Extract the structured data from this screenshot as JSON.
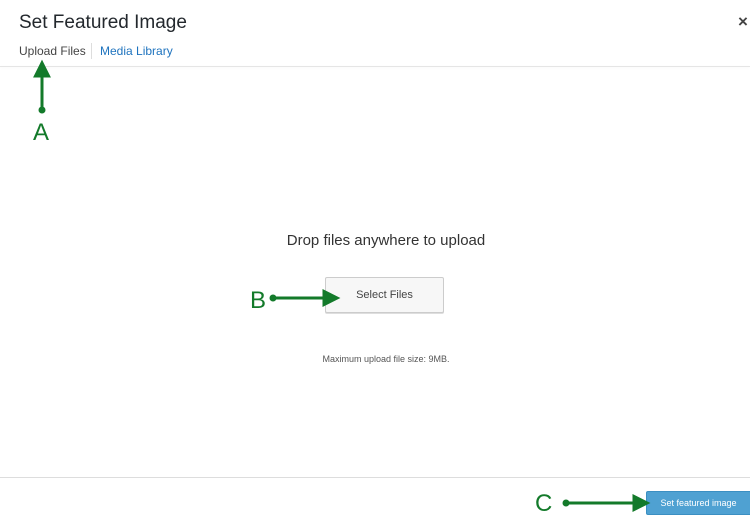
{
  "dialog": {
    "title": "Set Featured Image",
    "close_glyph": "×",
    "tabs": [
      {
        "label": "Upload Files",
        "active": true
      },
      {
        "label": "Media Library",
        "active": false
      }
    ]
  },
  "uploader": {
    "heading": "Drop files anywhere to upload",
    "select_button_label": "Select Files",
    "max_size_text": "Maximum upload file size: 9MB."
  },
  "footer": {
    "primary_button_label": "Set featured image"
  },
  "annotations": {
    "color": "#137a2a",
    "labels": [
      "A",
      "B",
      "C"
    ]
  },
  "colors": {
    "link": "#1e73be",
    "primary_button": "#4fa1d2"
  }
}
